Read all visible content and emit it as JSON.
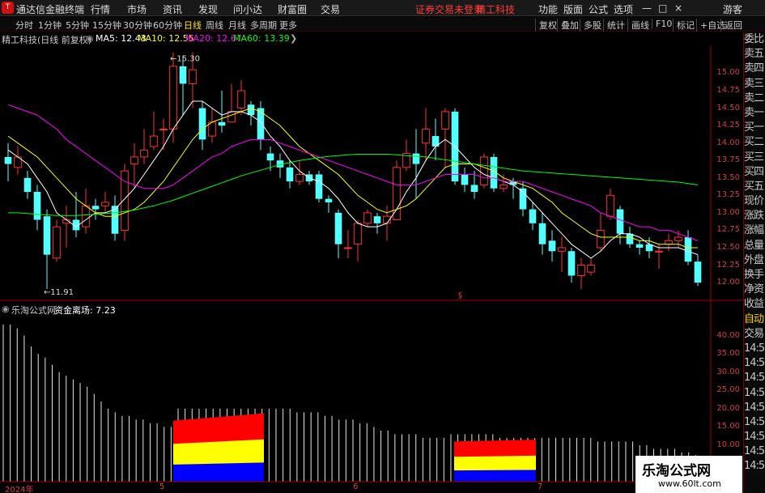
{
  "topbar": {
    "app_title": "通达信金融终端",
    "menus": [
      "行情",
      "市场",
      "资讯",
      "发现",
      "问小达",
      "财富圈",
      "交易"
    ],
    "notice": "证券交易未登录",
    "stock": "精工科技",
    "right_menus": [
      "功能",
      "版面",
      "公式",
      "选项"
    ],
    "guest": "游客",
    "controls": [
      "—",
      "□",
      "×"
    ]
  },
  "toolbar": {
    "periods": [
      "分时",
      "1分钟",
      "5分钟",
      "15分钟",
      "30分钟",
      "60分钟",
      "日线",
      "周线",
      "月线",
      "多周期",
      "更多"
    ],
    "active": "日线",
    "buttons": [
      "复权",
      "叠加",
      "多股",
      "统计",
      "画线",
      "F10",
      "标记",
      "+自选",
      "返回"
    ]
  },
  "main_info": {
    "title": "精工科技(日线 前复权)",
    "ma5": "MA5: 12.43",
    "ma10": "MA10: 12.55",
    "ma20": "MA20: 12.67",
    "ma60": "MA60: 13.39",
    "max_label": "15.30",
    "min_label": "11.91",
    "marker": "§"
  },
  "sub_info": {
    "title": "乐淘公式网",
    "indicator": "资金离场: 7.23"
  },
  "price_axis": [
    "15.00",
    "14.75",
    "14.50",
    "14.25",
    "14.00",
    "13.75",
    "13.50",
    "13.25",
    "13.00",
    "12.75",
    "12.50",
    "12.25",
    "12.00"
  ],
  "vol_axis": [
    "40.00",
    "35.00",
    "30.00",
    "25.00",
    "20.00",
    "15.00",
    "10.00"
  ],
  "date_labels": [
    "2024年",
    "5",
    "6",
    "7"
  ],
  "right_panel": [
    "委比",
    "卖五",
    "卖四",
    "卖三",
    "卖二",
    "卖一",
    "买一",
    "买二",
    "买三",
    "买四",
    "买五",
    "现价",
    "涨跌",
    "涨幅",
    "总量",
    "外盘",
    "换手",
    "净资",
    "收益",
    "自动",
    "交易",
    "14:56",
    "14:56",
    "14:56",
    "14:56",
    "14:56",
    "14:56",
    "14:56",
    "14:56",
    "14:56"
  ],
  "watermark": {
    "line1": "乐淘公式网",
    "line2": "www.60lt.com"
  },
  "colors": {
    "up": "#ff3232",
    "down": "#54ffff",
    "ma5": "#ffffff",
    "ma10": "#ffff00",
    "ma20": "#ff00ff",
    "ma60": "#00ff00",
    "axis": "#d04040"
  },
  "chart_data": [
    {
      "type": "candlestick",
      "title": "精工科技(日线 前复权)",
      "ylim": [
        11.85,
        15.4
      ],
      "candles": [
        [
          13.8,
          13.7,
          14.0,
          13.45
        ],
        [
          13.65,
          13.8,
          13.95,
          13.55
        ],
        [
          13.5,
          13.3,
          13.6,
          13.2
        ],
        [
          13.3,
          12.9,
          13.4,
          12.75
        ],
        [
          12.95,
          12.4,
          13.05,
          11.91
        ],
        [
          12.35,
          12.8,
          12.9,
          12.3
        ],
        [
          12.85,
          12.9,
          13.1,
          12.5
        ],
        [
          12.9,
          12.75,
          13.3,
          12.65
        ],
        [
          12.8,
          13.1,
          13.35,
          12.7
        ],
        [
          13.1,
          13.05,
          13.2,
          12.9
        ],
        [
          13.1,
          13.15,
          13.3,
          13.0
        ],
        [
          13.1,
          12.7,
          13.25,
          12.6
        ],
        [
          12.75,
          13.6,
          13.7,
          12.6
        ],
        [
          13.7,
          13.8,
          14.0,
          13.35
        ],
        [
          13.8,
          13.9,
          14.2,
          13.7
        ],
        [
          13.95,
          14.1,
          14.45,
          13.9
        ],
        [
          14.2,
          14.2,
          14.35,
          13.9
        ],
        [
          14.2,
          15.1,
          15.3,
          14.0
        ],
        [
          15.1,
          14.85,
          15.25,
          14.4
        ],
        [
          14.85,
          15.05,
          15.3,
          14.5
        ],
        [
          14.5,
          14.05,
          14.6,
          13.9
        ],
        [
          14.1,
          14.3,
          14.5,
          14.0
        ],
        [
          14.3,
          14.25,
          14.75,
          14.15
        ],
        [
          14.3,
          14.45,
          14.85,
          14.3
        ],
        [
          14.5,
          14.75,
          14.9,
          14.4
        ],
        [
          14.55,
          14.4,
          14.6,
          14.25
        ],
        [
          14.5,
          14.05,
          14.6,
          13.9
        ],
        [
          13.85,
          13.75,
          13.95,
          13.6
        ],
        [
          13.75,
          13.65,
          13.85,
          13.5
        ],
        [
          13.65,
          13.45,
          13.75,
          13.35
        ],
        [
          13.45,
          13.55,
          13.75,
          13.4
        ],
        [
          13.55,
          13.45,
          13.6,
          13.4
        ],
        [
          13.55,
          13.2,
          13.6,
          13.15
        ],
        [
          13.2,
          13.15,
          13.25,
          13.0
        ],
        [
          13.0,
          12.55,
          13.05,
          12.35
        ],
        [
          12.5,
          12.5,
          12.75,
          12.35
        ],
        [
          12.55,
          12.85,
          12.9,
          12.3
        ],
        [
          12.85,
          13.0,
          13.05,
          12.8
        ],
        [
          12.95,
          12.85,
          13.0,
          12.7
        ],
        [
          12.85,
          12.95,
          13.1,
          12.6
        ],
        [
          12.9,
          13.65,
          13.75,
          12.9
        ],
        [
          13.65,
          13.85,
          14.05,
          13.6
        ],
        [
          13.85,
          13.7,
          14.2,
          13.2
        ],
        [
          14.0,
          14.2,
          14.5,
          13.75
        ],
        [
          14.1,
          13.95,
          14.35,
          13.75
        ],
        [
          14.2,
          14.45,
          14.5,
          13.65
        ],
        [
          14.45,
          13.45,
          14.5,
          13.4
        ],
        [
          13.55,
          13.4,
          13.65,
          13.3
        ],
        [
          13.4,
          13.3,
          13.6,
          13.2
        ],
        [
          13.4,
          13.8,
          13.85,
          13.35
        ],
        [
          13.8,
          13.35,
          13.85,
          13.3
        ],
        [
          13.35,
          13.4,
          13.55,
          13.3
        ],
        [
          13.45,
          13.4,
          13.5,
          13.2
        ],
        [
          13.35,
          13.05,
          13.45,
          12.95
        ],
        [
          13.05,
          12.85,
          13.15,
          12.75
        ],
        [
          12.85,
          12.55,
          13.0,
          12.4
        ],
        [
          12.6,
          12.45,
          12.75,
          12.3
        ],
        [
          12.45,
          12.5,
          12.65,
          12.15
        ],
        [
          12.45,
          12.1,
          12.5,
          12.0
        ],
        [
          12.1,
          12.25,
          12.35,
          11.91
        ],
        [
          12.15,
          12.25,
          12.35,
          12.1
        ],
        [
          12.5,
          12.75,
          13.0,
          12.45
        ],
        [
          12.95,
          13.25,
          13.35,
          12.9
        ],
        [
          13.05,
          12.7,
          13.1,
          12.55
        ],
        [
          12.7,
          12.55,
          12.8,
          12.5
        ],
        [
          12.55,
          12.5,
          12.6,
          12.4
        ],
        [
          12.55,
          12.45,
          12.65,
          12.35
        ],
        [
          12.45,
          12.45,
          12.55,
          12.2
        ],
        [
          12.55,
          12.6,
          12.7,
          12.45
        ],
        [
          12.6,
          12.65,
          12.75,
          12.5
        ],
        [
          12.65,
          12.3,
          12.75,
          12.25
        ],
        [
          12.3,
          12.0,
          12.4,
          11.95
        ]
      ],
      "series": [
        {
          "name": "MA5",
          "values": [
            13.9,
            13.8,
            13.7,
            13.5,
            13.3,
            13.0,
            12.9,
            12.8,
            12.9,
            13.0,
            13.0,
            13.05,
            13.2,
            13.35,
            13.55,
            13.75,
            13.95,
            14.2,
            14.4,
            14.6,
            14.6,
            14.5,
            14.4,
            14.45,
            14.45,
            14.4,
            14.3,
            14.1,
            13.95,
            13.75,
            13.6,
            13.5,
            13.45,
            13.35,
            13.2,
            13.0,
            12.85,
            12.8,
            12.8,
            12.85,
            13.05,
            13.3,
            13.5,
            13.75,
            13.95,
            14.05,
            13.95,
            13.8,
            13.65,
            13.55,
            13.5,
            13.45,
            13.4,
            13.3,
            13.15,
            13.0,
            12.85,
            12.7,
            12.55,
            12.45,
            12.35,
            12.45,
            12.6,
            12.7,
            12.7,
            12.65,
            12.55,
            12.5,
            12.5,
            12.5,
            12.45,
            12.4
          ]
        },
        {
          "name": "MA10",
          "values": [
            14.1,
            14.0,
            13.9,
            13.8,
            13.65,
            13.5,
            13.35,
            13.2,
            13.1,
            13.0,
            12.95,
            12.95,
            13.0,
            13.05,
            13.15,
            13.3,
            13.45,
            13.65,
            13.85,
            14.05,
            14.2,
            14.3,
            14.35,
            14.4,
            14.45,
            14.5,
            14.45,
            14.35,
            14.25,
            14.1,
            13.95,
            13.85,
            13.75,
            13.65,
            13.55,
            13.4,
            13.25,
            13.15,
            13.05,
            13.0,
            13.05,
            13.1,
            13.2,
            13.35,
            13.5,
            13.65,
            13.7,
            13.7,
            13.7,
            13.65,
            13.6,
            13.5,
            13.45,
            13.4,
            13.35,
            13.25,
            13.15,
            13.0,
            12.9,
            12.8,
            12.7,
            12.65,
            12.65,
            12.65,
            12.65,
            12.6,
            12.6,
            12.55,
            12.55,
            12.55,
            12.5,
            12.5
          ]
        },
        {
          "name": "MA20",
          "values": [
            14.55,
            14.5,
            14.45,
            14.4,
            14.3,
            14.2,
            14.05,
            13.95,
            13.85,
            13.75,
            13.65,
            13.55,
            13.45,
            13.4,
            13.35,
            13.35,
            13.35,
            13.4,
            13.5,
            13.6,
            13.7,
            13.8,
            13.85,
            13.95,
            14.0,
            14.05,
            14.05,
            14.05,
            14.0,
            13.95,
            13.9,
            13.85,
            13.8,
            13.75,
            13.7,
            13.65,
            13.6,
            13.55,
            13.5,
            13.45,
            13.4,
            13.4,
            13.4,
            13.45,
            13.5,
            13.55,
            13.55,
            13.55,
            13.55,
            13.5,
            13.5,
            13.45,
            13.45,
            13.45,
            13.4,
            13.35,
            13.3,
            13.25,
            13.2,
            13.15,
            13.1,
            13.0,
            12.95,
            12.9,
            12.85,
            12.8,
            12.8,
            12.75,
            12.75,
            12.7,
            12.65,
            12.6
          ]
        },
        {
          "name": "MA60",
          "values": [
            13.0,
            13.0,
            12.99,
            12.98,
            12.97,
            12.96,
            12.96,
            12.96,
            12.97,
            12.98,
            12.99,
            13.0,
            13.02,
            13.04,
            13.07,
            13.1,
            13.14,
            13.18,
            13.23,
            13.28,
            13.33,
            13.38,
            13.43,
            13.48,
            13.53,
            13.57,
            13.61,
            13.65,
            13.69,
            13.72,
            13.75,
            13.77,
            13.79,
            13.81,
            13.82,
            13.83,
            13.84,
            13.84,
            13.84,
            13.84,
            13.83,
            13.82,
            13.81,
            13.8,
            13.78,
            13.76,
            13.74,
            13.72,
            13.7,
            13.68,
            13.66,
            13.64,
            13.62,
            13.6,
            13.59,
            13.58,
            13.57,
            13.56,
            13.55,
            13.54,
            13.53,
            13.52,
            13.51,
            13.5,
            13.49,
            13.48,
            13.47,
            13.46,
            13.45,
            13.44,
            13.42,
            13.4
          ]
        }
      ]
    },
    {
      "type": "bar",
      "title": "乐淘公式网",
      "ylim": [
        0,
        45
      ],
      "series": [
        {
          "name": "资金离场",
          "values": [
            43,
            43,
            42,
            40,
            37,
            35,
            34,
            32,
            30,
            29,
            28,
            27,
            26,
            24,
            22,
            20,
            19,
            18,
            18,
            17,
            17,
            16,
            16,
            15,
            15,
            20,
            20,
            20,
            20,
            20,
            20,
            20,
            20,
            20,
            20,
            20,
            20,
            20,
            20,
            20,
            20,
            20,
            19,
            19,
            19,
            19,
            18,
            18,
            17,
            17,
            17,
            16,
            16,
            15,
            14,
            14,
            13,
            13,
            13,
            13,
            12,
            12,
            12,
            12,
            13,
            13,
            13,
            13,
            13,
            13,
            13,
            12,
            12,
            12,
            12,
            12,
            12,
            12,
            12,
            12,
            12,
            12,
            12,
            12,
            12,
            11,
            11,
            11,
            11,
            11,
            11,
            10,
            10,
            9,
            9,
            9,
            9,
            8,
            8,
            7.23
          ]
        }
      ]
    }
  ]
}
